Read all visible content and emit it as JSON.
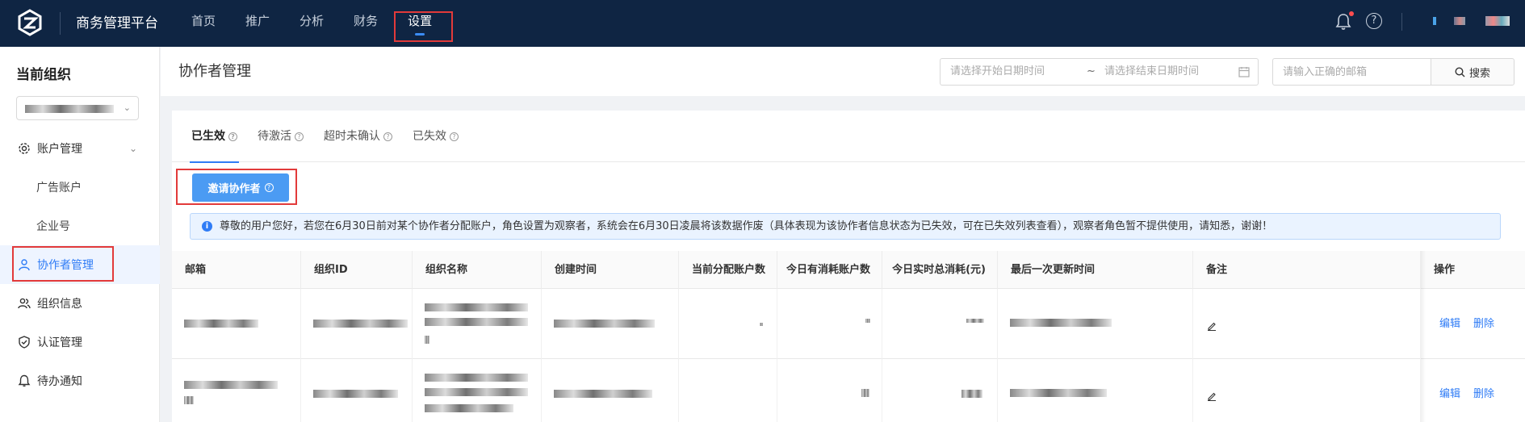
{
  "header": {
    "brand": "商务管理平台",
    "nav": [
      "首页",
      "推广",
      "分析",
      "财务",
      "设置"
    ],
    "active_nav": "设置",
    "help_glyph": "?"
  },
  "sidebar": {
    "org_title": "当前组织",
    "org_select_value": "",
    "items": [
      {
        "label": "账户管理",
        "icon": "gear-icon"
      },
      {
        "label": "广告账户",
        "icon": ""
      },
      {
        "label": "企业号",
        "icon": ""
      },
      {
        "label": "协作者管理",
        "icon": "user-icon"
      },
      {
        "label": "组织信息",
        "icon": "users-icon"
      },
      {
        "label": "认证管理",
        "icon": "shield-icon"
      },
      {
        "label": "待办通知",
        "icon": "bell-icon"
      }
    ]
  },
  "main": {
    "title": "协作者管理",
    "date_start_placeholder": "请选择开始日期时间",
    "date_sep": "~",
    "date_end_placeholder": "请选择结束日期时间",
    "email_placeholder": "请输入正确的邮箱",
    "search_label": "搜索",
    "tabs": [
      "已生效",
      "待激活",
      "超时未确认",
      "已失效"
    ],
    "invite_label": "邀请协作者",
    "notice": "尊敬的用户您好，若您在6月30日前对某个协作者分配账户，角色设置为观察者，系统会在6月30日凌晨将该数据作废（具体表现为该协作者信息状态为已失效，可在已失效列表查看），观察者角色暂不提供使用，请知悉，谢谢！",
    "columns": [
      "邮箱",
      "组织ID",
      "组织名称",
      "创建时间",
      "当前分配账户数",
      "今日有消耗账户数",
      "今日实时总消耗(元)",
      "最后一次更新时间",
      "备注",
      "操作"
    ],
    "row_actions": {
      "edit": "编辑",
      "delete": "删除"
    },
    "row_count": 2,
    "info_glyph": "i"
  }
}
